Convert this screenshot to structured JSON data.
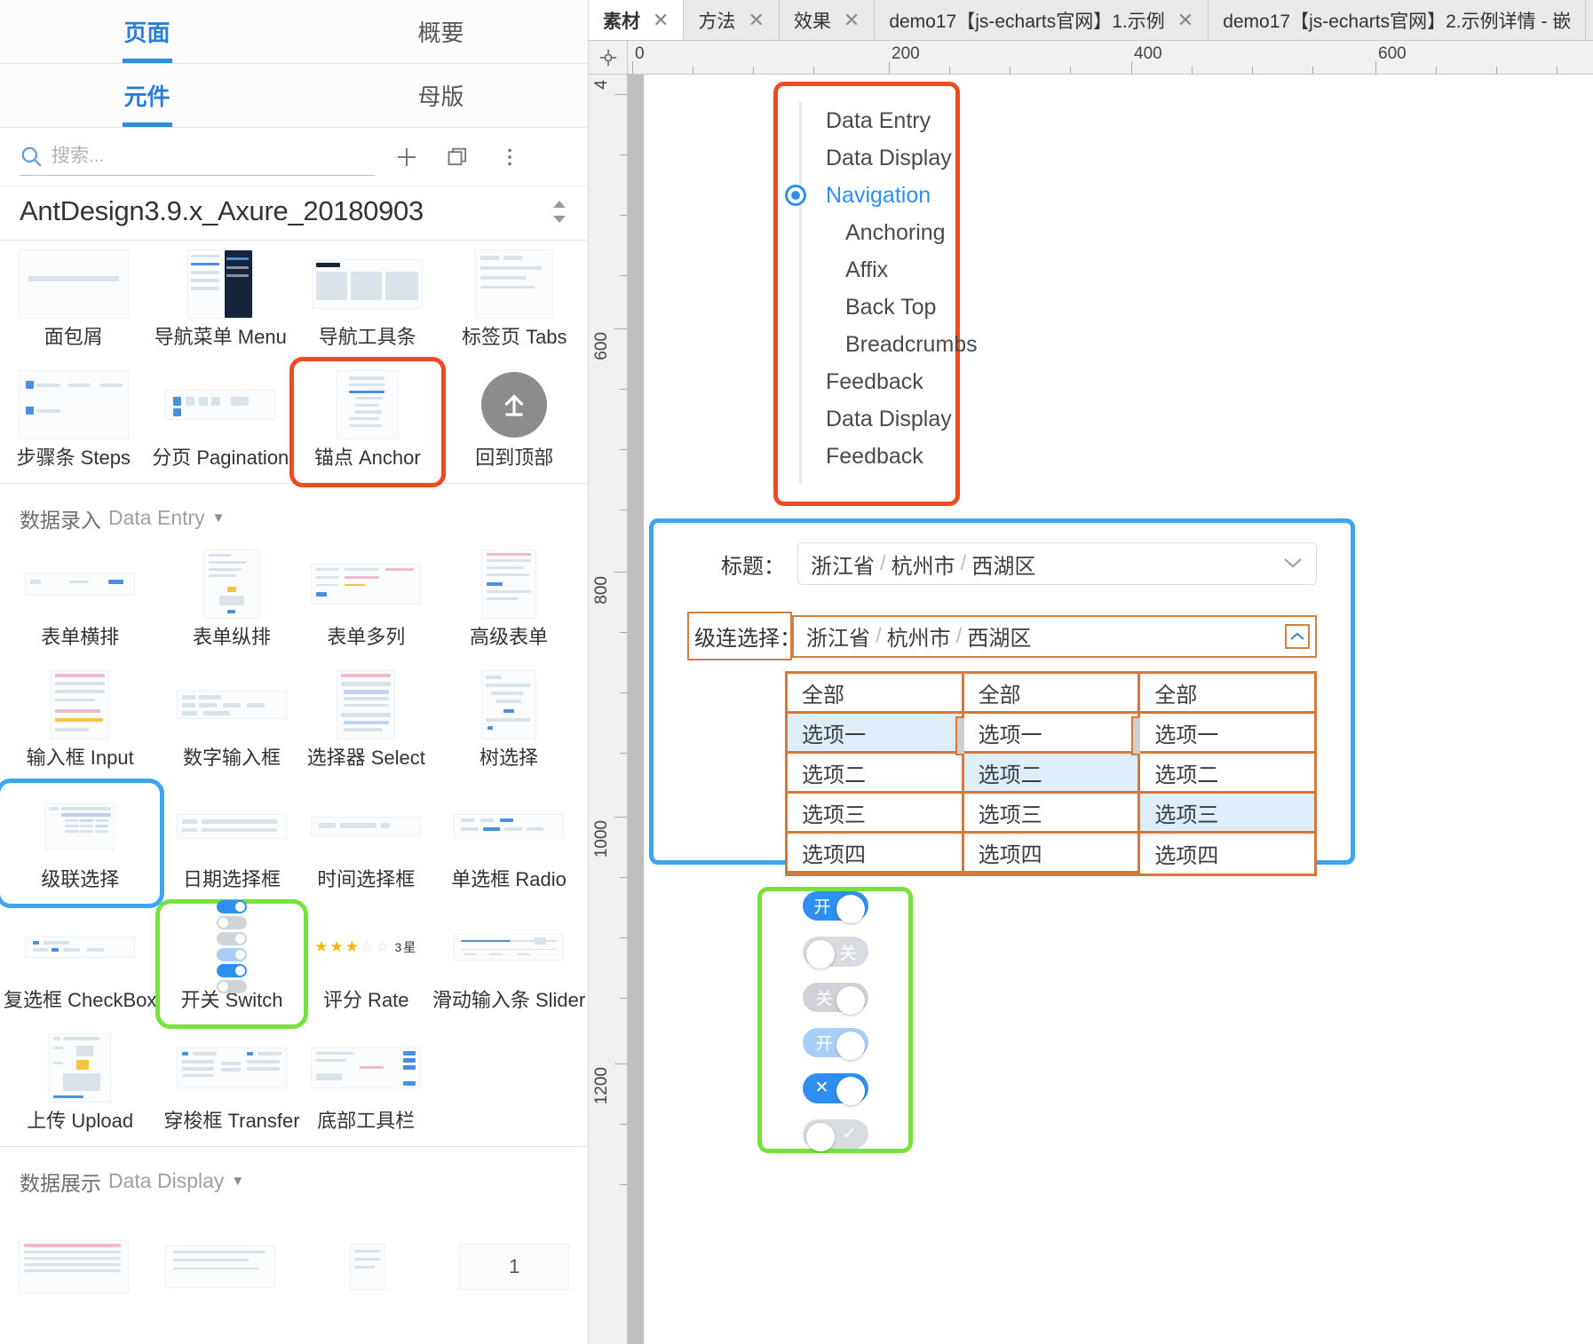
{
  "sidebar": {
    "tabs_row1": [
      {
        "label": "页面",
        "active": true
      },
      {
        "label": "概要",
        "active": false
      }
    ],
    "tabs_row2": [
      {
        "label": "元件",
        "active": true
      },
      {
        "label": "母版",
        "active": false
      }
    ],
    "search": {
      "placeholder": "搜索...",
      "value": "",
      "icon": "search-icon"
    },
    "actions": [
      {
        "name": "add-library-button",
        "glyph": "+"
      },
      {
        "name": "duplicate-library-button",
        "glyph": "❐"
      },
      {
        "name": "more-options-button",
        "glyph": "⋮"
      }
    ],
    "library_name": "AntDesign3.9.x_Axure_20180903",
    "navigation_items": [
      {
        "label": "面包屑",
        "thumb": "breadcrumb",
        "highlight": ""
      },
      {
        "label": "导航菜单 Menu",
        "thumb": "menu",
        "highlight": ""
      },
      {
        "label": "导航工具条",
        "thumb": "navbar",
        "highlight": ""
      },
      {
        "label": "标签页 Tabs",
        "thumb": "tabs",
        "highlight": ""
      },
      {
        "label": "步骤条 Steps",
        "thumb": "steps",
        "highlight": ""
      },
      {
        "label": "分页 Pagination",
        "thumb": "pagination",
        "highlight": ""
      },
      {
        "label": "锚点 Anchor",
        "thumb": "anchor",
        "highlight": "red"
      },
      {
        "label": "回到顶部",
        "thumb": "backtop",
        "highlight": ""
      }
    ],
    "data_entry_section": {
      "title_zh": "数据录入",
      "title_en": "Data Entry",
      "caret": "▼"
    },
    "data_entry_items": [
      {
        "label": "表单横排",
        "thumb": "form-h",
        "highlight": ""
      },
      {
        "label": "表单纵排",
        "thumb": "form-v",
        "highlight": ""
      },
      {
        "label": "表单多列",
        "thumb": "form-multi",
        "highlight": ""
      },
      {
        "label": "高级表单",
        "thumb": "form-adv",
        "highlight": ""
      },
      {
        "label": "输入框 Input",
        "thumb": "input",
        "highlight": ""
      },
      {
        "label": "数字输入框",
        "thumb": "number",
        "highlight": ""
      },
      {
        "label": "选择器 Select",
        "thumb": "select",
        "highlight": ""
      },
      {
        "label": "树选择",
        "thumb": "treeselect",
        "highlight": ""
      },
      {
        "label": "级联选择",
        "thumb": "cascader",
        "highlight": "blue"
      },
      {
        "label": "日期选择框",
        "thumb": "datepicker",
        "highlight": ""
      },
      {
        "label": "时间选择框",
        "thumb": "timepicker",
        "highlight": ""
      },
      {
        "label": "单选框 Radio",
        "thumb": "radio",
        "highlight": ""
      },
      {
        "label": "复选框 CheckBox",
        "thumb": "checkbox",
        "highlight": ""
      },
      {
        "label": "开关 Switch",
        "thumb": "switch",
        "highlight": "green"
      },
      {
        "label": "评分 Rate",
        "thumb": "rate",
        "highlight": ""
      },
      {
        "label": "滑动输入条 Slider",
        "thumb": "slider",
        "highlight": ""
      },
      {
        "label": "上传 Upload",
        "thumb": "upload",
        "highlight": ""
      },
      {
        "label": "穿梭框 Transfer",
        "thumb": "transfer",
        "highlight": ""
      },
      {
        "label": "底部工具栏",
        "thumb": "toolbar",
        "highlight": ""
      }
    ],
    "data_display_section": {
      "title_zh": "数据展示",
      "title_en": "Data Display",
      "caret": "▼"
    },
    "data_display_items": [
      {
        "label": "",
        "thumb": "table",
        "highlight": ""
      },
      {
        "label": "",
        "thumb": "list",
        "highlight": ""
      },
      {
        "label": "",
        "thumb": "card",
        "highlight": ""
      },
      {
        "label": "",
        "thumb": "carousel",
        "highlight": ""
      }
    ],
    "rate_preview": {
      "filled": 3,
      "total": 5,
      "label": "3星"
    }
  },
  "editor_tabs": [
    {
      "label": "素材",
      "active": true,
      "closable": true
    },
    {
      "label": "方法",
      "active": false,
      "closable": true
    },
    {
      "label": "效果",
      "active": false,
      "closable": true
    },
    {
      "label": "demo17【js-echarts官网】1.示例",
      "active": false,
      "closable": true
    },
    {
      "label": "demo17【js-echarts官网】2.示例详情 - 嵌",
      "active": false,
      "closable": false
    }
  ],
  "rulers": {
    "horizontal_labels": [
      "0",
      "200",
      "400",
      "600"
    ],
    "vertical_labels": [
      "4",
      "600",
      "800",
      "1000",
      "1200"
    ],
    "origin_icon": "crosshair-icon"
  },
  "canvas": {
    "anchor_widget": {
      "highlight_color": "#ef4b23",
      "items": [
        {
          "label": "Data Entry",
          "level": 1,
          "active": false
        },
        {
          "label": "Data Display",
          "level": 1,
          "active": false
        },
        {
          "label": "Navigation",
          "level": 1,
          "active": true
        },
        {
          "label": "Anchoring",
          "level": 2,
          "active": false
        },
        {
          "label": "Affix",
          "level": 2,
          "active": false
        },
        {
          "label": "Back Top",
          "level": 2,
          "active": false
        },
        {
          "label": "Breadcrumbs",
          "level": 2,
          "active": false
        },
        {
          "label": "Feedback",
          "level": 1,
          "active": false
        },
        {
          "label": "Data Display",
          "level": 1,
          "active": false
        },
        {
          "label": "Feedback",
          "level": 1,
          "active": false
        }
      ]
    },
    "cascader_widget": {
      "highlight_color": "#3ba6ef",
      "field_title": {
        "label": "标题：",
        "value_parts": [
          "浙江省",
          "杭州市",
          "西湖区"
        ],
        "separator": "/",
        "chevron": "chevron-down-icon"
      },
      "field_cascader": {
        "label": "级连选择：",
        "value_parts": [
          "浙江省",
          "杭州市",
          "西湖区"
        ],
        "separator": "/",
        "chevron": "chevron-up-icon",
        "label_highlight": "#d08040"
      },
      "columns": [
        {
          "options": [
            {
              "label": "全部",
              "selected": false
            },
            {
              "label": "选项一",
              "selected": true
            },
            {
              "label": "选项二",
              "selected": false
            },
            {
              "label": "选项三",
              "selected": false
            },
            {
              "label": "选项四",
              "selected": false
            }
          ]
        },
        {
          "options": [
            {
              "label": "全部",
              "selected": false
            },
            {
              "label": "选项一",
              "selected": false
            },
            {
              "label": "选项二",
              "selected": true
            },
            {
              "label": "选项三",
              "selected": false
            },
            {
              "label": "选项四",
              "selected": false
            }
          ]
        },
        {
          "options": [
            {
              "label": "全部",
              "selected": false
            },
            {
              "label": "选项一",
              "selected": false
            },
            {
              "label": "选项二",
              "selected": false
            },
            {
              "label": "选项三",
              "selected": true
            },
            {
              "label": "选项四",
              "selected": false
            }
          ]
        }
      ]
    },
    "switch_widget": {
      "highlight_color": "#78e23c",
      "switches": [
        {
          "state": "on",
          "label": "开",
          "kind": "on"
        },
        {
          "state": "off",
          "label": "关",
          "kind": "off"
        },
        {
          "state": "disabled-off",
          "label": "关",
          "kind": "dis-off"
        },
        {
          "state": "disabled-on",
          "label": "开",
          "kind": "dis-on"
        },
        {
          "state": "icon-on",
          "label": "✕",
          "kind": "icon-on"
        },
        {
          "state": "icon-off",
          "label": "✓",
          "kind": "icon-off"
        }
      ]
    }
  }
}
